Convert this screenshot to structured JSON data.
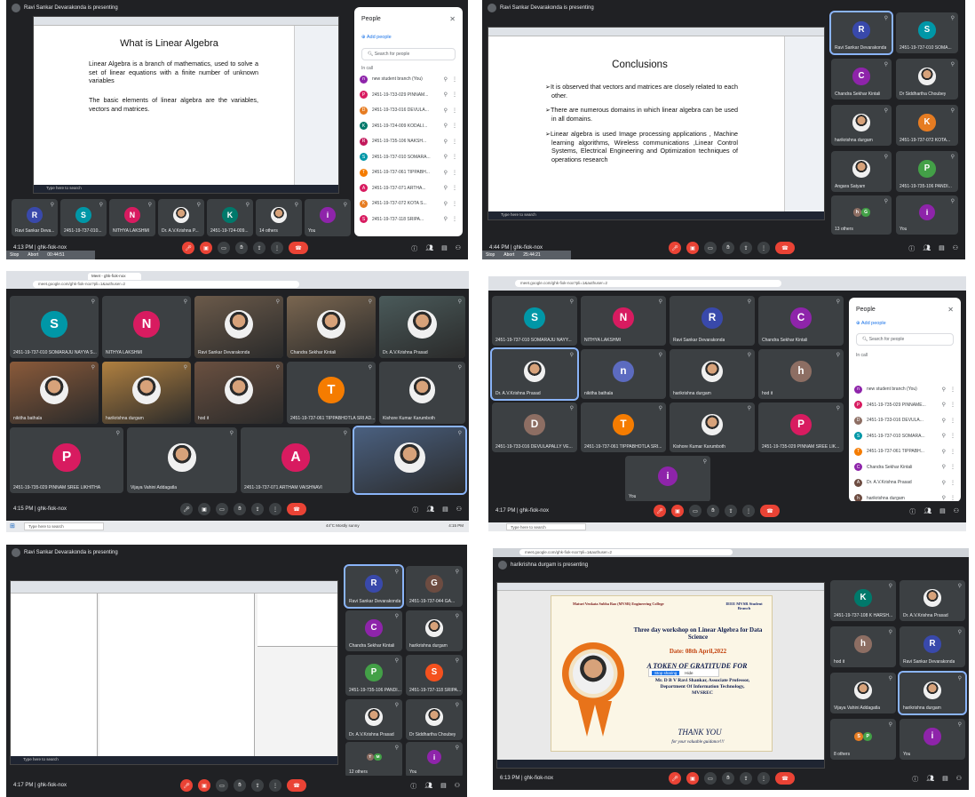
{
  "p1": {
    "presenting": "Ravi Sankar Devarakonda is presenting",
    "slide_title": "What is Linear Algebra",
    "slide_p1": "Linear Algebra is a branch of mathematics, used to solve a set of linear equations with a finite number of unknown variables",
    "slide_p2": "The basic elements of linear algebra are the variables, vectors and matrices.",
    "taskbar_search": "Type here to search",
    "people_title": "People",
    "add_people": "Add people",
    "search_people": "Search for people",
    "in_call": "In call",
    "people_list": [
      {
        "i": "n",
        "name": "new student branch (You)",
        "c": "#8e24aa"
      },
      {
        "i": "P",
        "name": "2451-19-733-029 PINNAM...",
        "c": "#d81b60"
      },
      {
        "i": "D",
        "name": "2451-19-733-016 DEVULA...",
        "c": "#e67c22"
      },
      {
        "i": "K",
        "name": "2451-19-724-009 KODALI...",
        "c": "#00796b"
      },
      {
        "i": "R",
        "name": "2451-19-735-106 NAKSH...",
        "c": "#c2185b"
      },
      {
        "i": "S",
        "name": "2451-19-737-010 SOMARA...",
        "c": "#0097a7"
      },
      {
        "i": "T",
        "name": "2451-19-737-061 TIPPABH...",
        "c": "#f57c00"
      },
      {
        "i": "A",
        "name": "2451-19-737-071 ARTHA...",
        "c": "#d81b60"
      },
      {
        "i": "K",
        "name": "2451-19-737-072 KOTA S...",
        "c": "#e67c22"
      },
      {
        "i": "S",
        "name": "2451-19-737-118 SRIPA...",
        "c": "#d81b60"
      }
    ],
    "tiles": [
      {
        "i": "R",
        "name": "Ravi Sankar Deva...",
        "c": "#3949ab"
      },
      {
        "i": "S",
        "name": "2451-19-737-010...",
        "c": "#0097a7"
      },
      {
        "i": "N",
        "name": "NITHYA LAKSHMI",
        "c": "#d81b60"
      },
      {
        "i": "",
        "name": "Dr. A.V.Krishna P...",
        "c": "#3c4043"
      },
      {
        "i": "K",
        "name": "2451-19-724-009...",
        "c": "#00796b"
      },
      {
        "i": "",
        "name": "14 others",
        "c": "#3c4043"
      },
      {
        "i": "i",
        "name": "You",
        "c": "#8e24aa"
      }
    ],
    "time": "4:13 PM",
    "code": "ghk-fiok-nox",
    "stop": "Stop",
    "abort": "Abort",
    "timer": "00:44:51"
  },
  "p2": {
    "presenting": "Ravi Sankar Devarakonda is presenting",
    "slide_title": "Conclusions",
    "bullets": [
      "It is observed that vectors and matrices are closely related to each other.",
      "There are numerous domains in which linear algebra can be used in all domains.",
      "Linear algebra is used Image processing applications , Machine learning algorithms, Wireless communications ,Linear Control Systems, Electrical Engineering and Optimization techniques of operations research"
    ],
    "taskbar_search": "Type here to search",
    "tiles": [
      {
        "i": "R",
        "name": "Ravi Sankar Devarakonda",
        "c": "#3949ab",
        "hl": true
      },
      {
        "i": "S",
        "name": "2451-19-737-010 SOMA...",
        "c": "#0097a7"
      },
      {
        "i": "C",
        "name": "Chandra Sekhar Kintali",
        "c": "#8e24aa"
      },
      {
        "i": "",
        "name": "Dr Siddhartha Choubey",
        "c": "#3c4043"
      },
      {
        "i": "",
        "name": "harikrishna durgam",
        "c": "#3c4043"
      },
      {
        "i": "K",
        "name": "2451-19-737-072 KOTA...",
        "c": "#e67c22"
      },
      {
        "i": "",
        "name": "Angara Satyam",
        "c": "#3c4043"
      },
      {
        "i": "P",
        "name": "2451-19-735-106 PANDI...",
        "c": "#43a047"
      },
      {
        "i": "hG",
        "name": "13 others",
        "c": "#3c4043"
      },
      {
        "i": "i",
        "name": "You",
        "c": "#8e24aa"
      }
    ],
    "time": "4:44 PM",
    "code": "ghk-fiok-nox",
    "stop": "Stop",
    "abort": "Abort",
    "timer": "25:44:21"
  },
  "p3": {
    "tab": "Meet - ghk-fiok-nox",
    "url": "meet.google.com/ghk-fiok-nox?pli=1&authuser=2",
    "tiles": [
      {
        "i": "S",
        "name": "2451-19-737-010 SOMARAJU NAYYA S...",
        "c": "#0097a7"
      },
      {
        "i": "N",
        "name": "NITHYA LAKSHMI",
        "c": "#d81b60"
      },
      {
        "i": "",
        "name": "Ravi Sankar Devarakonda",
        "c": "#6b5a4a",
        "video": true
      },
      {
        "i": "",
        "name": "Chandra Sekhar Kintali",
        "c": "#7a6650",
        "video": true
      },
      {
        "i": "",
        "name": "Dr. A.V.Krishna Prasad",
        "c": "#4a5a5a",
        "video": true
      },
      {
        "i": "",
        "name": "nikitha bathala",
        "c": "#8a5a3a",
        "video": true
      },
      {
        "i": "",
        "name": "harikrishna durgam",
        "c": "#b08040",
        "video": true
      },
      {
        "i": "",
        "name": "hod it",
        "c": "#6a5040",
        "video": true
      },
      {
        "i": "T",
        "name": "2451-19-737-061 TIPPABHOTLA SRI AD...",
        "c": "#f57c00"
      },
      {
        "i": "",
        "name": "Kishore Kumar Karumboth",
        "c": "#3c4043"
      },
      {
        "i": "P",
        "name": "2451-19-735-029 PINNAM SREE LIKHITHA",
        "c": "#d81b60"
      },
      {
        "i": "",
        "name": "Vijaya Vahini Addagatla",
        "c": "#3c4043"
      },
      {
        "i": "A",
        "name": "2451-19-737-071 ARTHAM VAISHNAVI",
        "c": "#d81b60"
      },
      {
        "i": "",
        "name": "",
        "c": "#4a6080",
        "video": true,
        "hl": true
      }
    ],
    "time": "4:15 PM",
    "code": "ghk-fiok-nox",
    "taskbar_search": "Type here to search",
    "weather": "44°C Mostly sunny",
    "clock": "4:15 PM"
  },
  "p4": {
    "url": "meet.google.com/ghk-fiok-nox?pli=1&authuser=2",
    "tiles": [
      {
        "i": "S",
        "name": "2451-19-737-010 SOMARAJU NAYY...",
        "c": "#0097a7"
      },
      {
        "i": "N",
        "name": "NITHYA LAKSHMI",
        "c": "#d81b60"
      },
      {
        "i": "R",
        "name": "Ravi Sankar Devarakonda",
        "c": "#3949ab"
      },
      {
        "i": "C",
        "name": "Chandra Sekhar Kintali",
        "c": "#8e24aa"
      },
      {
        "i": "",
        "name": "Dr. A.V.Krishna Prasad",
        "c": "#3c4043",
        "hl": true
      },
      {
        "i": "n",
        "name": "nikitha bathala",
        "c": "#5c6bc0"
      },
      {
        "i": "",
        "name": "harikrishna durgam",
        "c": "#3c4043"
      },
      {
        "i": "h",
        "name": "hod it",
        "c": "#8d6e63"
      },
      {
        "i": "D",
        "name": "2451-19-733-016 DEVULAPALLY VE...",
        "c": "#8d6e63"
      },
      {
        "i": "T",
        "name": "2451-19-737-061 TIPPABHOTLA SRI...",
        "c": "#f57c00"
      },
      {
        "i": "",
        "name": "Kishore Kumar Karumboth",
        "c": "#3c4043"
      },
      {
        "i": "P",
        "name": "2451-19-735-029 PINNAM SREE LIK...",
        "c": "#d81b60"
      },
      {
        "i": "i",
        "name": "You",
        "c": "#8e24aa"
      }
    ],
    "people_title": "People",
    "add_people": "Add people",
    "search_people": "Search for people",
    "in_call": "In call",
    "people_list": [
      {
        "i": "n",
        "name": "new student branch (You)",
        "c": "#8e24aa"
      },
      {
        "i": "P",
        "name": "2451-19-735-029 PINNAME...",
        "c": "#d81b60"
      },
      {
        "i": "D",
        "name": "2451-19-733-016 DEVULA...",
        "c": "#8d6e63"
      },
      {
        "i": "S",
        "name": "2451-19-737-010 SOMARA...",
        "c": "#0097a7"
      },
      {
        "i": "T",
        "name": "2451-19-737-061 TIPPABH...",
        "c": "#f57c00"
      },
      {
        "i": "C",
        "name": "Chandra Sekhar Kintali",
        "c": "#8e24aa"
      },
      {
        "i": "A",
        "name": "Dr. A.V.Krishna Prasad",
        "c": "#6d4c41"
      },
      {
        "i": "h",
        "name": "harikrishna durgam",
        "c": "#6d4c41"
      }
    ],
    "time": "4:17 PM",
    "code": "ghk-fiok-nox",
    "taskbar_search": "Type here to search"
  },
  "p5": {
    "presenting": "Ravi Sankar Devarakonda is presenting",
    "tiles": [
      {
        "i": "R",
        "name": "Ravi Sankar Devarakonda",
        "c": "#3949ab",
        "hl": true
      },
      {
        "i": "G",
        "name": "2451-19-737-044 GA...",
        "c": "#6d4c41"
      },
      {
        "i": "C",
        "name": "Chandra Sekhar Kintali",
        "c": "#8e24aa"
      },
      {
        "i": "",
        "name": "harikrishna durgam",
        "c": "#3c4043"
      },
      {
        "i": "P",
        "name": "2451-19-735-106 PANDI...",
        "c": "#43a047"
      },
      {
        "i": "S",
        "name": "2451-19-737-118 SRIPA...",
        "c": "#f4511e"
      },
      {
        "i": "",
        "name": "Dr. A.V.Krishna Prasad",
        "c": "#3c4043"
      },
      {
        "i": "",
        "name": "Dr Siddhartha Choubey",
        "c": "#3c4043"
      },
      {
        "i": "TM",
        "name": "12 others",
        "c": "#3c4043"
      },
      {
        "i": "i",
        "name": "You",
        "c": "#8e24aa"
      }
    ],
    "time": "4:17 PM",
    "code": "ghk-fiok-nox",
    "taskbar_search": "Type here to search"
  },
  "p6": {
    "presenting": "harikrishna durgam is presenting",
    "url": "meet.google.com/ghk-fiok-nox?pli=1&authuser=2",
    "cert_college": "Maturi Venkata Subba Rao (MVSR) Engineering College",
    "cert_branch": "IEEE MVSR Student Branch",
    "cert_event": "Three day workshop on Linear Algebra for Data Science",
    "cert_date": "Date: 08th April,2022",
    "cert_token": "A TOKEN OF GRATITUDE FOR",
    "cert_person": "Mr. D B V Ravi Shankar, Associate Professor, Department Of Information Technology, MVSREC",
    "cert_thanks": "THANK YOU",
    "cert_footer": "for your valuable guidance!!!",
    "tiles": [
      {
        "i": "K",
        "name": "2451-19-737-108 K HARSH...",
        "c": "#00796b"
      },
      {
        "i": "",
        "name": "Dr. A.V.Krishna Prasad",
        "c": "#3c4043"
      },
      {
        "i": "h",
        "name": "hod it",
        "c": "#8d6e63"
      },
      {
        "i": "R",
        "name": "Ravi Sankar Devarakonda",
        "c": "#3949ab"
      },
      {
        "i": "",
        "name": "Vijaya Vahini Addagatla",
        "c": "#3c4043"
      },
      {
        "i": "",
        "name": "harikrishna durgam",
        "c": "#3c4043",
        "hl": true
      },
      {
        "i": "SP",
        "name": "8 others",
        "c": "#3c4043"
      },
      {
        "i": "i",
        "name": "You",
        "c": "#8e24aa"
      }
    ],
    "time": "6:13 PM",
    "code": "ghk-fiok-nox",
    "stop_sharing": "Stop sharing",
    "hide": "Hide"
  }
}
